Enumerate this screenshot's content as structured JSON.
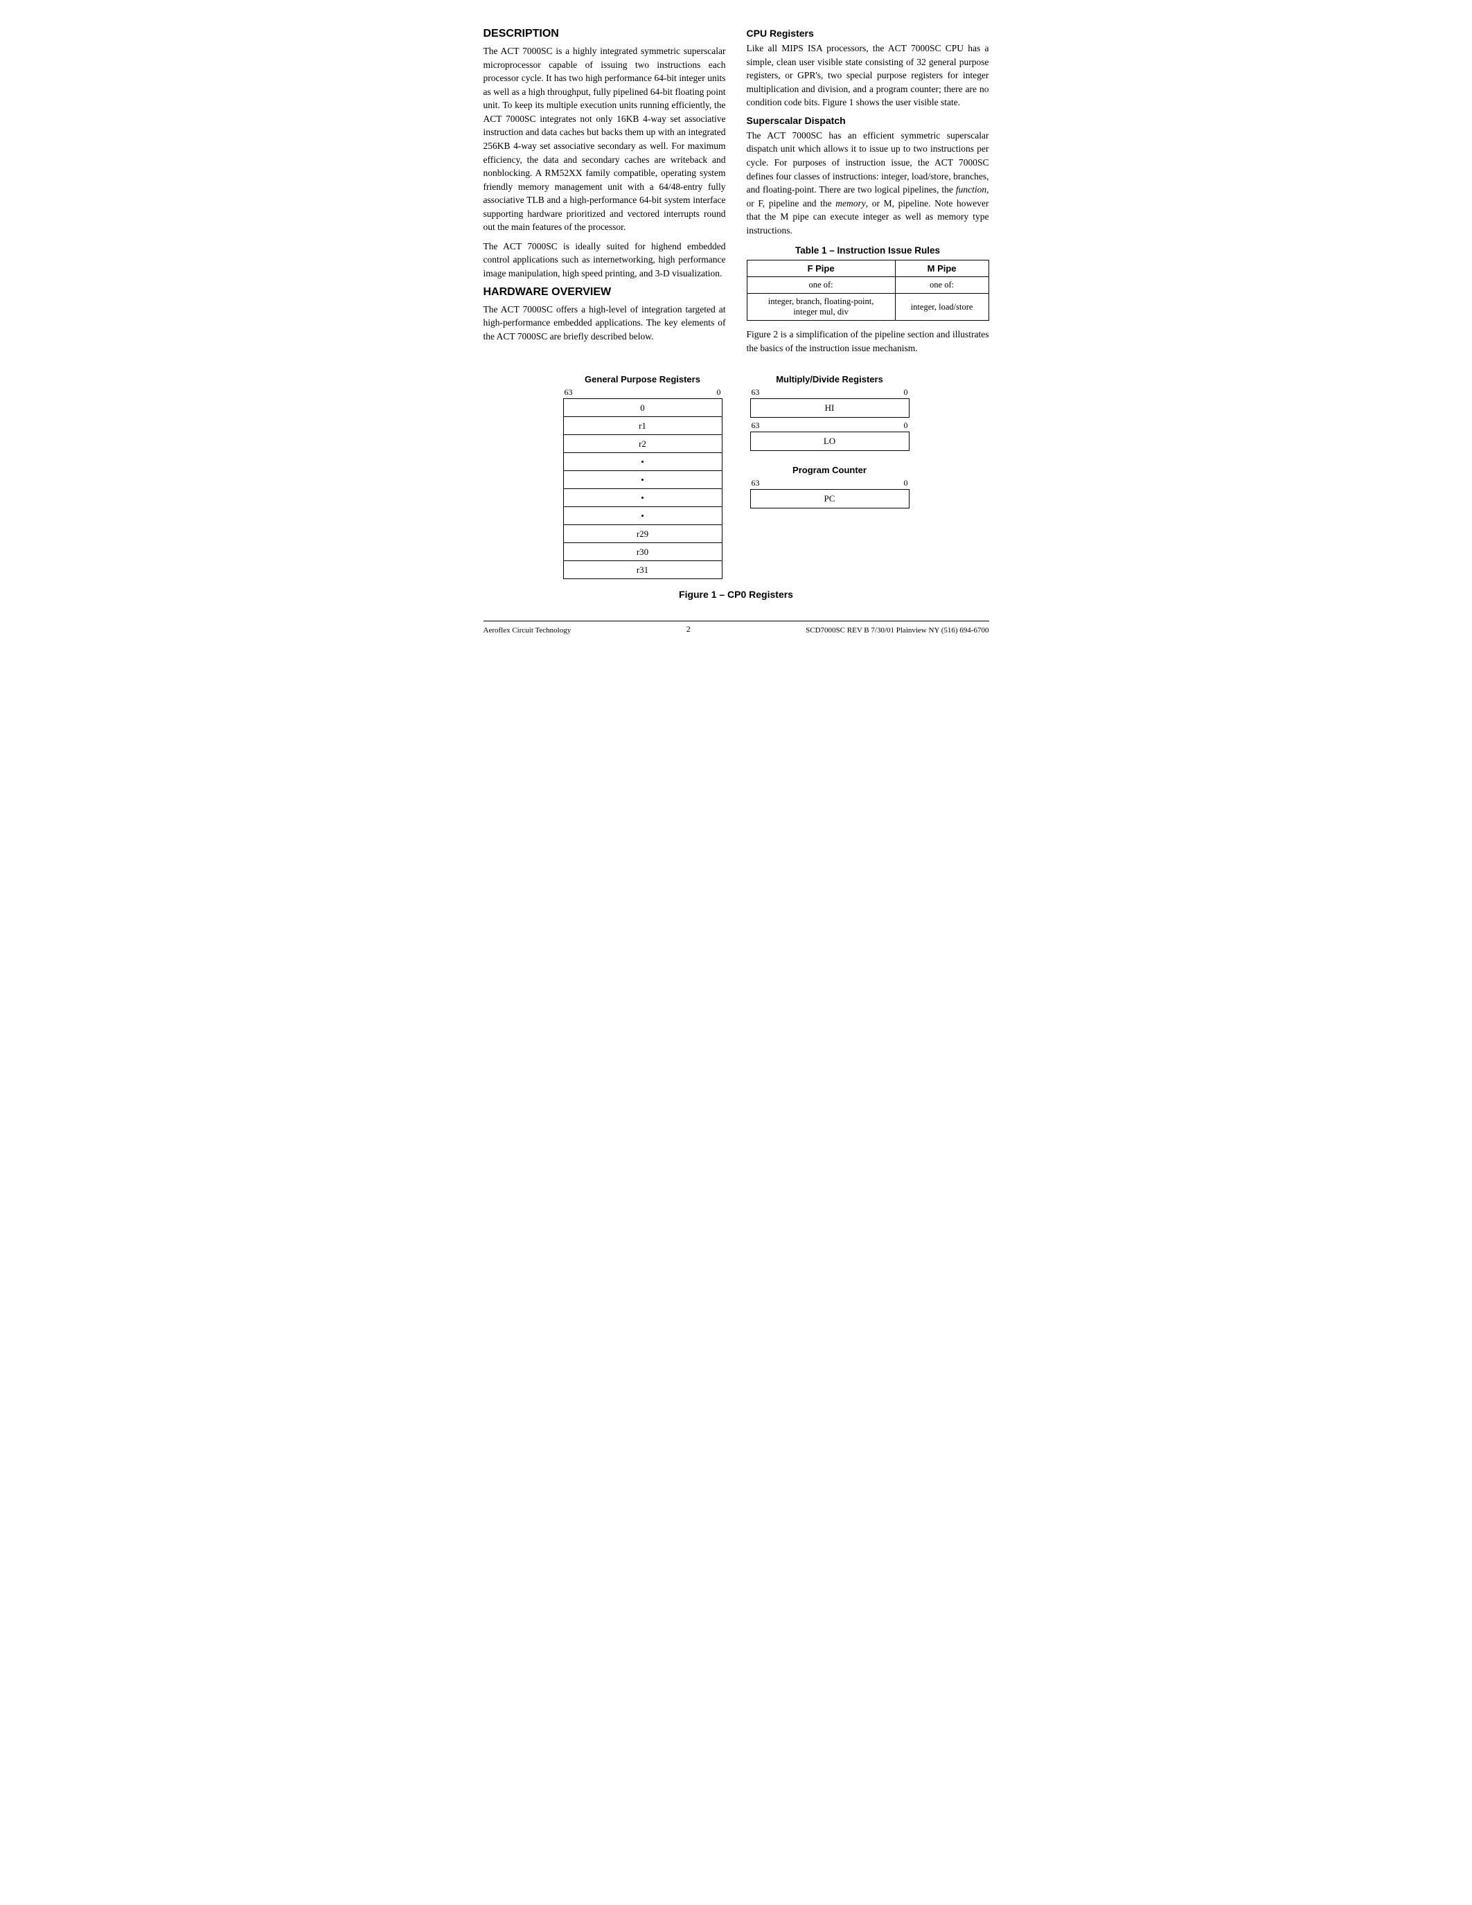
{
  "sections": {
    "description": {
      "title": "DESCRIPTION",
      "paragraphs": [
        "The ACT 7000SC is a highly integrated symmetric superscalar microprocessor capable of issuing two instructions each processor cycle. It has two high performance 64-bit integer units as well as a high throughput, fully pipelined 64-bit floating point unit. To keep its multiple execution units running efficiently, the ACT 7000SC integrates not only 16KB 4-way set associative instruction and data caches but backs them up with an integrated 256KB 4-way set associative secondary as well. For maximum efficiency, the data and secondary caches are writeback and nonblocking. A RM52XX family compatible, operating system friendly memory management unit with a 64/48-entry fully associative TLB and a high-performance 64-bit system interface supporting hardware prioritized and vectored interrupts round out the main features of the processor.",
        "The ACT 7000SC is ideally suited for highend embedded control applications such as internetworking, high performance image manipulation, high speed printing, and 3-D visualization."
      ]
    },
    "hardware_overview": {
      "title": "HARDWARE OVERVIEW",
      "paragraphs": [
        "The ACT 7000SC offers a high-level of integration targeted at high-performance embedded applications. The key elements of the ACT 7000SC are briefly described below."
      ]
    },
    "cpu_registers": {
      "title": "CPU Registers",
      "paragraphs": [
        "Like all MIPS ISA processors, the ACT 7000SC CPU has a simple, clean user visible state consisting of 32 general purpose registers, or GPR's, two special purpose registers for integer multiplication and division, and a program counter; there are no condition code bits. Figure 1 shows the user visible state."
      ]
    },
    "superscalar_dispatch": {
      "title": "Superscalar Dispatch",
      "paragraphs": [
        "The ACT 7000SC has an efficient symmetric superscalar dispatch unit which allows it to issue up to two instructions per cycle. For purposes of instruction issue, the ACT 7000SC defines four classes of instructions: integer, load/store, branches, and floating-point. There are two logical pipelines, the function, or F, pipeline and the memory, or M, pipeline. Note however that the M pipe can execute integer as well as memory type instructions."
      ]
    }
  },
  "table1": {
    "title": "Table 1 – Instruction Issue Rules",
    "headers": [
      "F Pipe",
      "M Pipe"
    ],
    "subheaders": [
      "one of:",
      "one of:"
    ],
    "rows": [
      [
        "integer, branch, floating-point, integer mul, div",
        "integer, load/store"
      ]
    ]
  },
  "table1_footnote": "Figure 2 is a simplification of the pipeline section and illustrates the basics of the instruction issue mechanism.",
  "diagrams": {
    "gpr": {
      "label": "General Purpose Registers",
      "bit_high": "63",
      "bit_low": "0",
      "rows": [
        "0",
        "r1",
        "r2",
        "•",
        "•",
        "•",
        "•",
        "r29",
        "r30",
        "r31"
      ]
    },
    "md": {
      "label": "Multiply/Divide Registers",
      "bit_high": "63",
      "bit_low": "0",
      "registers": [
        "HI",
        "LO"
      ]
    },
    "pc": {
      "label": "Program Counter",
      "bit_high": "63",
      "bit_low": "0",
      "register": "PC"
    }
  },
  "figure_caption": "Figure 1 – CP0 Registers",
  "footer": {
    "left": "Aeroflex Circuit Technology",
    "center": "2",
    "right": "SCD7000SC REV B  7/30/01  Plainview NY (516) 694-6700"
  }
}
